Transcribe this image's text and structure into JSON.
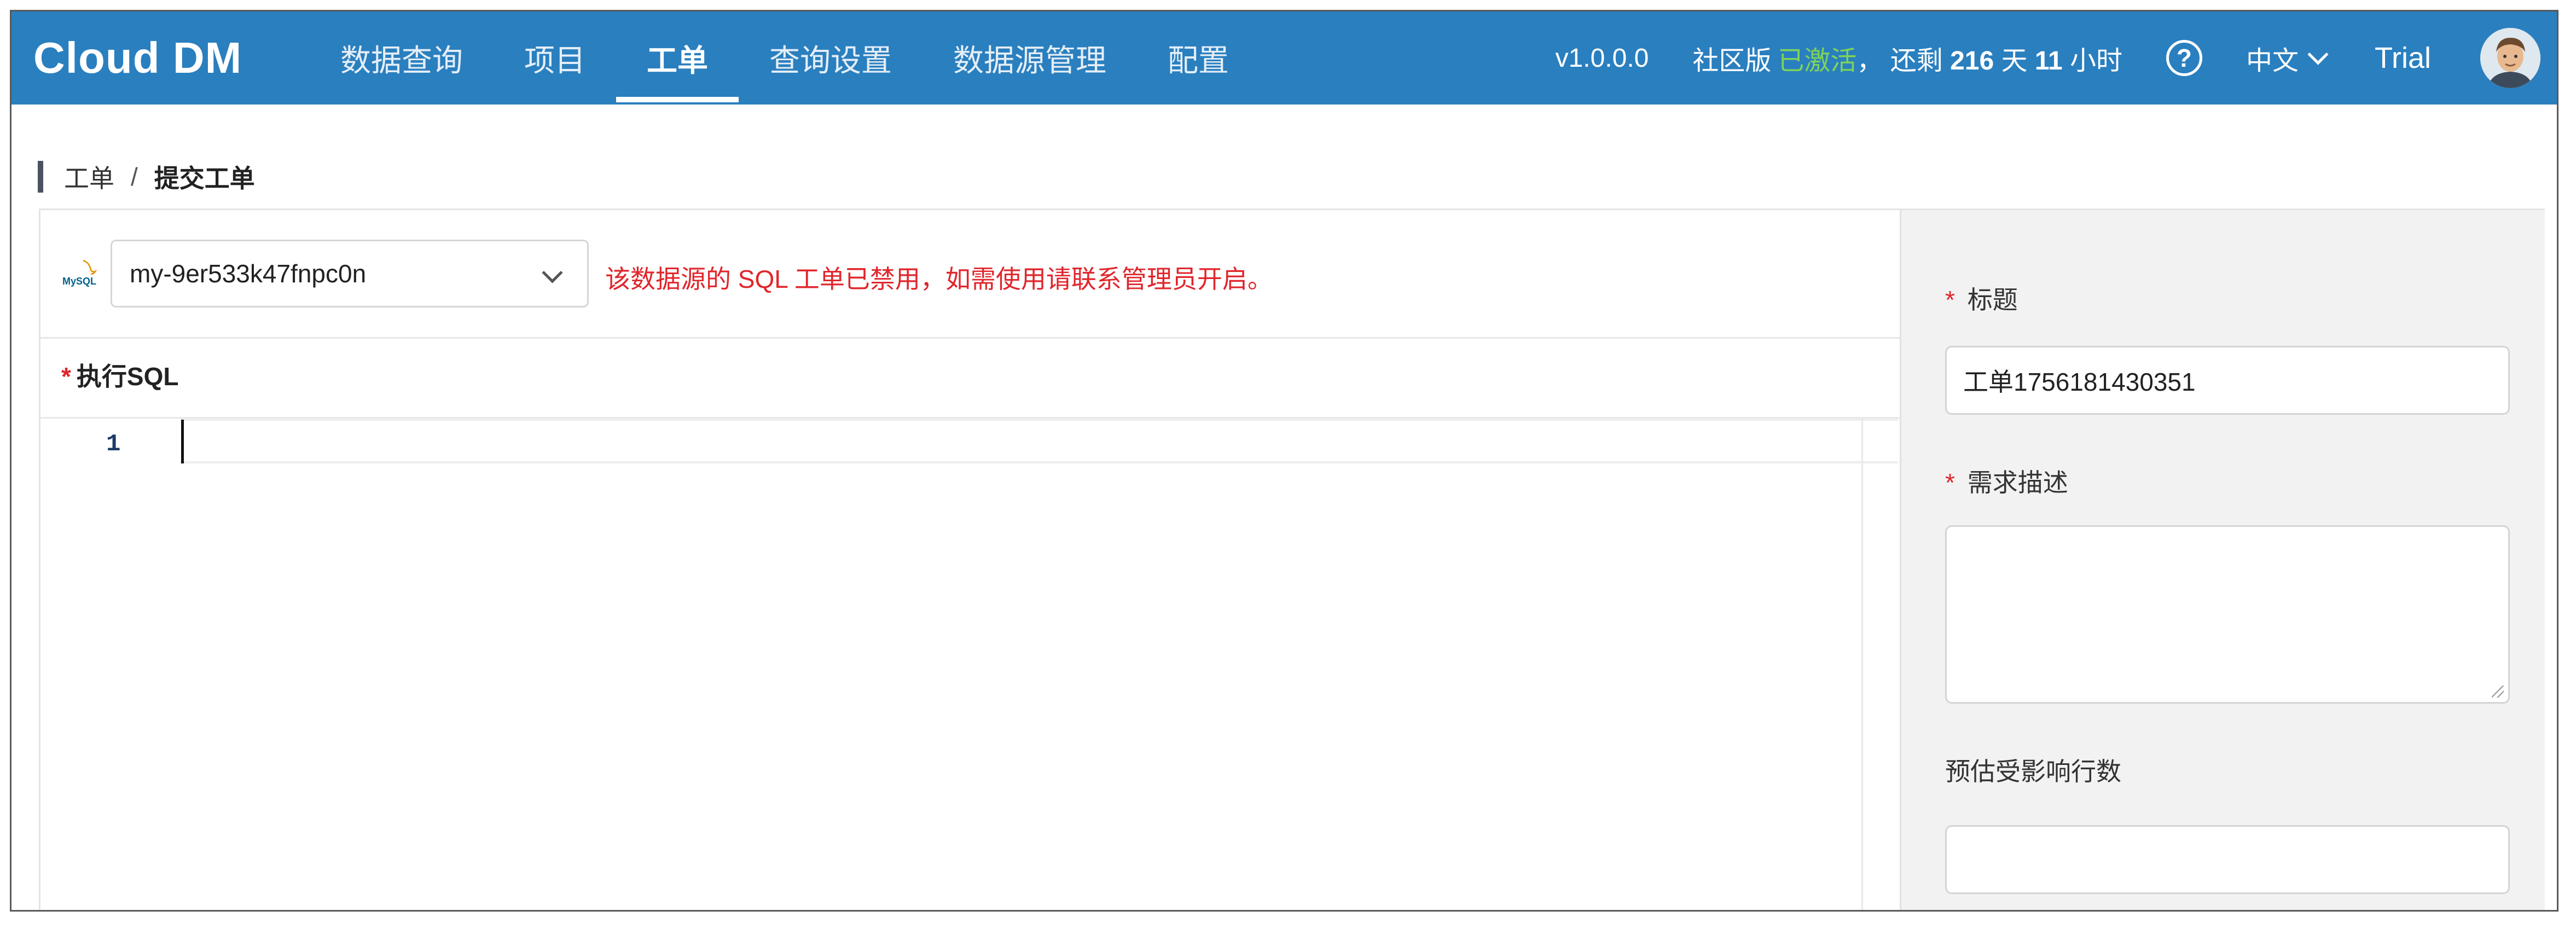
{
  "app": {
    "logo": "Cloud DM"
  },
  "nav": {
    "items": [
      {
        "label": "数据查询",
        "active": false
      },
      {
        "label": "项目",
        "active": false
      },
      {
        "label": "工单",
        "active": true
      },
      {
        "label": "查询设置",
        "active": false
      },
      {
        "label": "数据源管理",
        "active": false
      },
      {
        "label": "配置",
        "active": false
      }
    ]
  },
  "header": {
    "version": "v1.0.0.0",
    "edition": "社区版",
    "activated": "已激活",
    "remaining_prefix": "， 还剩",
    "days": "216",
    "days_unit": "天",
    "hours": "11",
    "hours_unit": "小时",
    "help_icon": "?",
    "language": "中文",
    "trial": "Trial",
    "colors": {
      "topbar": "#2a7fbf",
      "activated": "#7dd35a"
    }
  },
  "breadcrumb": {
    "root": "工单",
    "separator": "/",
    "current": "提交工单"
  },
  "datasource": {
    "icon_text": "MySQL",
    "selected": "my-9er533k47fnpc0n",
    "warning": "该数据源的 SQL 工单已禁用，如需使用请联系管理员开启。",
    "warning_color": "#e0262c"
  },
  "sql": {
    "required_mark": "*",
    "label": "执行SQL",
    "line_number": "1"
  },
  "form": {
    "title_label": "标题",
    "title_value": "工单1756181430351",
    "desc_label": "需求描述",
    "desc_value": "",
    "rows_label": "预估受影响行数",
    "rows_value": "",
    "required_mark": "*"
  }
}
